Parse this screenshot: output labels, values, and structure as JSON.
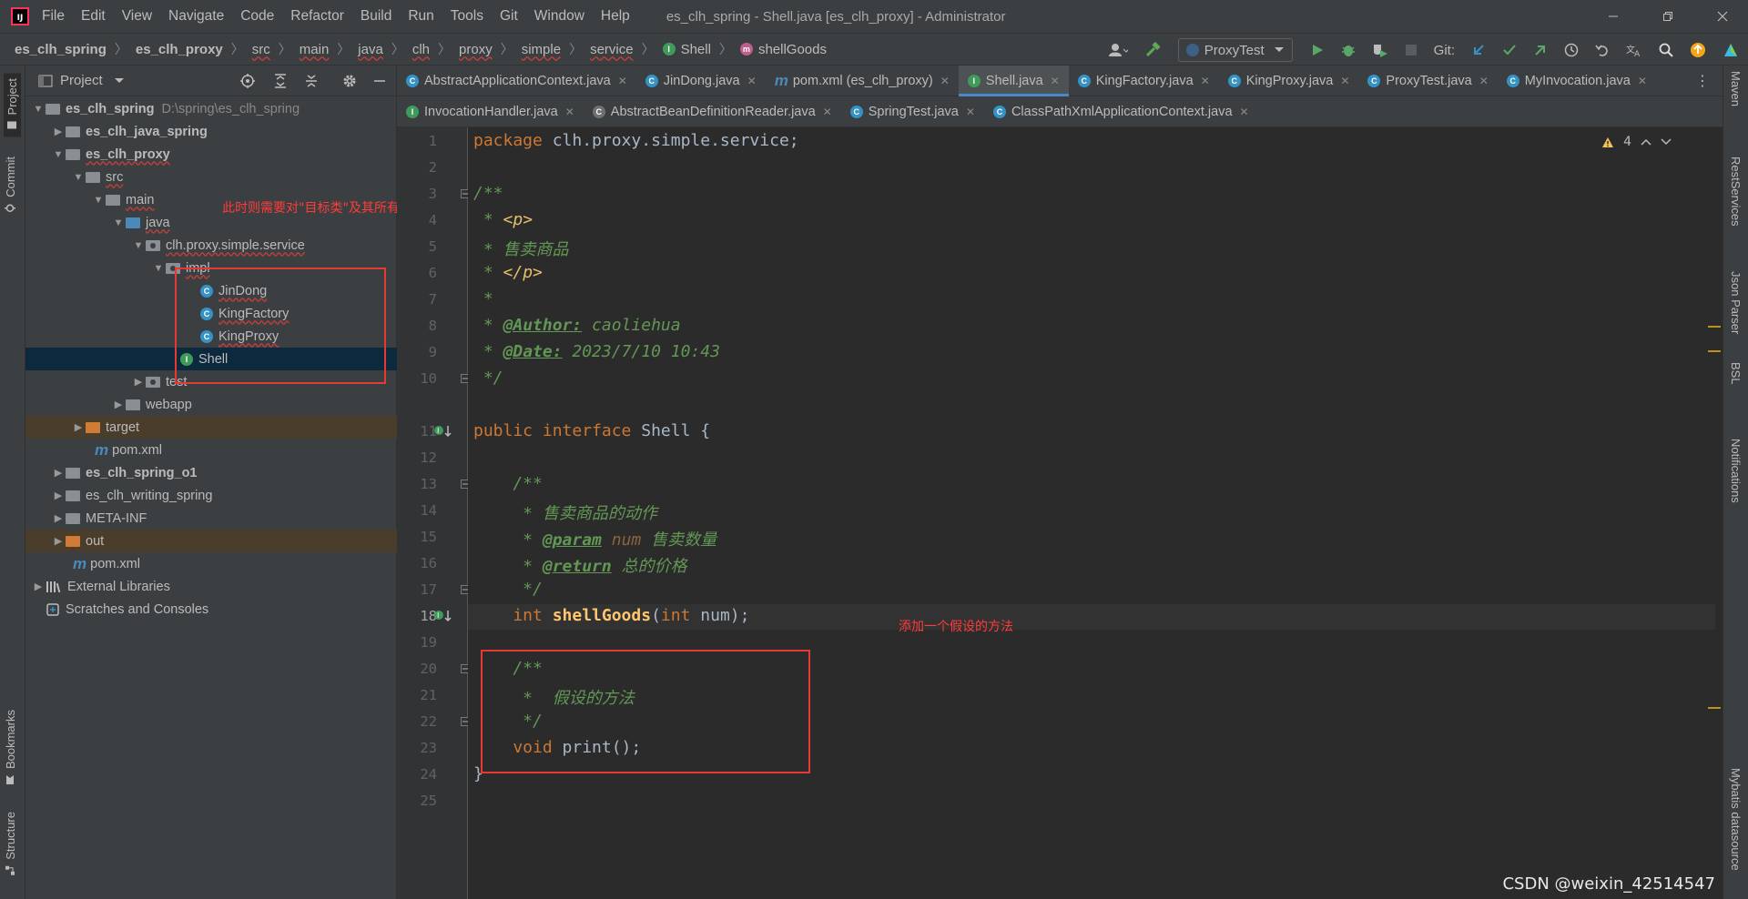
{
  "app": {
    "window_title": "es_clh_spring - Shell.java [es_clh_proxy] - Administrator",
    "logo_text": "IJ"
  },
  "menu": [
    "File",
    "Edit",
    "View",
    "Navigate",
    "Code",
    "Refactor",
    "Build",
    "Run",
    "Tools",
    "Git",
    "Window",
    "Help"
  ],
  "breadcrumbs": [
    "es_clh_spring",
    "es_clh_proxy",
    "src",
    "main",
    "java",
    "clh",
    "proxy",
    "simple",
    "service",
    "Shell",
    "shellGoods"
  ],
  "toolbar": {
    "run_config": "ProxyTest",
    "git_label": "Git:"
  },
  "left_stripe": {
    "project": "Project",
    "commit": "Commit",
    "bookmarks": "Bookmarks",
    "structure": "Structure"
  },
  "right_stripe": [
    "Maven",
    "RestServices",
    "Json Parser",
    "BSL",
    "Notifications",
    "Mybatis datasource"
  ],
  "project_panel": {
    "title": "Project",
    "tree": [
      {
        "label": "es_clh_spring",
        "path": "D:\\spring\\es_clh_spring",
        "bold": true
      },
      {
        "label": "es_clh_java_spring",
        "bold": true
      },
      {
        "label": "es_clh_proxy",
        "bold": true
      },
      {
        "label": "src"
      },
      {
        "label": "main"
      },
      {
        "label": "java"
      },
      {
        "label": "clh.proxy.simple.service"
      },
      {
        "label": "impl"
      },
      {
        "label": "JinDong"
      },
      {
        "label": "KingFactory"
      },
      {
        "label": "KingProxy"
      },
      {
        "label": "Shell"
      },
      {
        "label": "test"
      },
      {
        "label": "webapp"
      },
      {
        "label": "target"
      },
      {
        "label": "pom.xml"
      },
      {
        "label": "es_clh_spring_o1",
        "bold": true
      },
      {
        "label": "es_clh_writing_spring"
      },
      {
        "label": "META-INF"
      },
      {
        "label": "out"
      },
      {
        "label": "pom.xml"
      },
      {
        "label": "External Libraries"
      },
      {
        "label": "Scratches and Consoles"
      }
    ]
  },
  "tabs_row1": [
    "AbstractApplicationContext.java",
    "JinDong.java",
    "pom.xml (es_clh_proxy)",
    "Shell.java",
    "KingFactory.java",
    "KingProxy.java",
    "ProxyTest.java",
    "MyInvocation.java"
  ],
  "tabs_row2": [
    "InvocationHandler.java",
    "AbstractBeanDefinitionReader.java",
    "SpringTest.java",
    "ClassPathXmlApplicationContext.java"
  ],
  "editor": {
    "warning_count": "4",
    "lines": {
      "l1_kw": "package",
      "l1_rest": " clh.proxy.simple.service;",
      "l3": "/**",
      "l4_pre": " * ",
      "l4_tag": "<p>",
      "l5": " * 售卖商品",
      "l6_pre": " * ",
      "l6_tag": "</p>",
      "l7": " *",
      "l8_pre": " * ",
      "l8_ann": "@Author:",
      "l8_rest": " caoliehua",
      "l9_pre": " * ",
      "l9_ann": "@Date:",
      "l9_rest": " 2023/7/10 10:43",
      "l10": " */",
      "l11_kw": "public interface",
      "l11_rest": " Shell {",
      "l13": "    /**",
      "l14": "     * 售卖商品的动作",
      "l15_pre": "     * ",
      "l15_ann": "@param",
      "l15_par": " num",
      "l15_rest": " 售卖数量",
      "l16_pre": "     * ",
      "l16_ann": "@return",
      "l16_rest": " 总的价格",
      "l17": "     */",
      "l18_kw": "    int",
      "l18_fn": " shellGoods",
      "l18_p1": "(",
      "l18_kw2": "int",
      "l18_p2": " num);",
      "l20": "    /**",
      "l21": "     *  假设的方法",
      "l22": "     */",
      "l23_kw": "    void",
      "l23_rest": " print();",
      "l24": "}"
    }
  },
  "annotations": {
    "note1": "此时则需要对\"目标类\"及其所有的代理类，都进行修改才行",
    "note2": "添加一个假设的方法"
  },
  "watermark": "CSDN @weixin_42514547"
}
